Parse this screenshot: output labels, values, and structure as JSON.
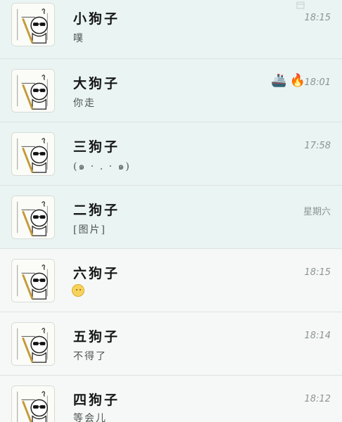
{
  "chats": [
    {
      "name": "小狗子",
      "preview": "噗",
      "time": "18:15",
      "style": "tinted",
      "avatar_icon": "sunglasses-cartoon-avatar",
      "extra_icon": "mute-icon"
    },
    {
      "name": "大狗子",
      "preview": "你走",
      "time": "18:01",
      "style": "tinted",
      "avatar_icon": "sunglasses-cartoon-avatar",
      "badges": [
        "🚢",
        "🔥"
      ]
    },
    {
      "name": "三狗子",
      "preview": "(๑ · . · ๑)",
      "time": "17:58",
      "style": "tinted",
      "avatar_icon": "sunglasses-cartoon-avatar"
    },
    {
      "name": "二狗子",
      "preview": "[图片]",
      "time": "星期六",
      "style": "tinted",
      "avatar_icon": "sunglasses-cartoon-avatar"
    },
    {
      "name": "六狗子",
      "preview": "",
      "time": "18:15",
      "style": "plain",
      "avatar_icon": "sunglasses-cartoon-avatar",
      "preview_icon": "smile-emoji-icon"
    },
    {
      "name": "五狗子",
      "preview": "不得了",
      "time": "18:14",
      "style": "plain",
      "avatar_icon": "sunglasses-cartoon-avatar"
    },
    {
      "name": "四狗子",
      "preview": "等会儿",
      "time": "18:12",
      "style": "plain",
      "avatar_icon": "sunglasses-cartoon-avatar"
    }
  ],
  "colors": {
    "tinted_row": "#eaf4f3",
    "plain_row": "#f6f8f7",
    "divider": "#dde3e1",
    "time": "#8a9492"
  }
}
